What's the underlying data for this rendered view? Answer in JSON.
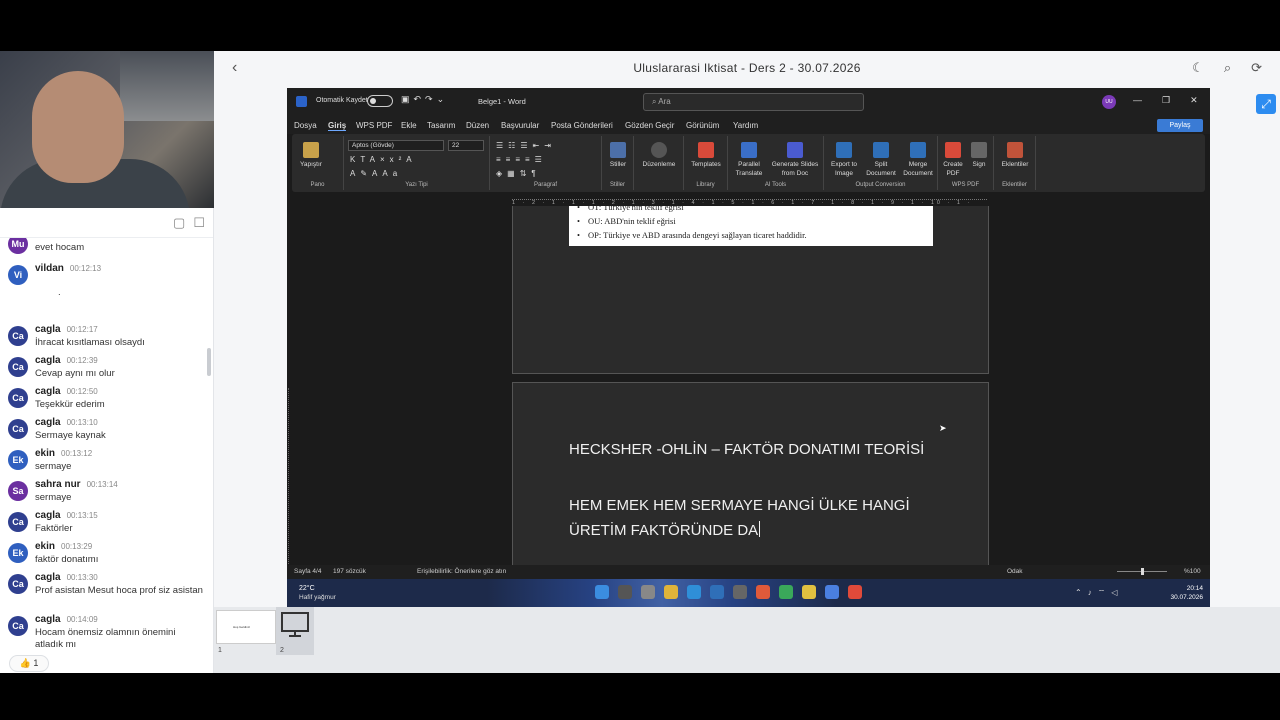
{
  "header": {
    "title": "Uluslararasi Iktisat - Ders 2 - 30.07.2026",
    "back_icon": "‹",
    "icons": [
      "moon-icon",
      "search-icon",
      "refresh-icon"
    ]
  },
  "chat": {
    "messages": [
      {
        "initials": "Mu",
        "name": "",
        "time": "",
        "text": "evet hocam"
      },
      {
        "initials": "Vi",
        "name": "vildan",
        "time": "00:12:13",
        "text": "."
      },
      {
        "initials": "Ca",
        "name": "cagla",
        "time": "00:12:17",
        "text": "İhracat kısıtlaması olsaydı"
      },
      {
        "initials": "Ca",
        "name": "cagla",
        "time": "00:12:39",
        "text": "Cevap aynı mı olur"
      },
      {
        "initials": "Ca",
        "name": "cagla",
        "time": "00:12:50",
        "text": "Teşekkür ederim"
      },
      {
        "initials": "Ca",
        "name": "cagla",
        "time": "00:13:10",
        "text": "Sermaye kaynak"
      },
      {
        "initials": "Ek",
        "name": "ekin",
        "time": "00:13:12",
        "text": "sermaye"
      },
      {
        "initials": "Sa",
        "name": "sahra nur",
        "time": "00:13:14",
        "text": "sermaye"
      },
      {
        "initials": "Ca",
        "name": "cagla",
        "time": "00:13:15",
        "text": "Faktörler"
      },
      {
        "initials": "Ek",
        "name": "ekin",
        "time": "00:13:29",
        "text": "faktör donatımı"
      },
      {
        "initials": "Ca",
        "name": "cagla",
        "time": "00:13:30",
        "text": "Prof asistan Mesut hoca prof siz asistan"
      },
      {
        "initials": "Ca",
        "name": "cagla",
        "time": "00:14:09",
        "text": "Hocam önemsiz olamnın önemini atladık mı"
      }
    ],
    "reaction": "👍 1"
  },
  "word": {
    "autosave": "Otomatik Kaydet",
    "doc_name": "Belge1 - Word",
    "search_placeholder": "Ara",
    "user_initials": "UU",
    "menu": [
      "Dosya",
      "Giriş",
      "WPS PDF",
      "Ekle",
      "Tasarım",
      "Düzen",
      "Başvurular",
      "Posta Gönderileri",
      "Gözden Geçir",
      "Görünüm",
      "Yardım"
    ],
    "share": "Paylaş",
    "font_name": "Aptos (Gövde)",
    "font_size": "22",
    "ribbon_groups": [
      "Pano",
      "Yazı Tipi",
      "Paragraf",
      "Stiller",
      "Library",
      "AI Tools",
      "Output Conversion",
      "WPS PDF",
      "Eklentiler"
    ],
    "ribbon_buttons": {
      "paste": "Yapıştır",
      "styles": "Stiller",
      "editing": "Düzenleme",
      "templates": "Templates",
      "parallel": "Parallel Translate",
      "generate": "Generate Slides from Doc",
      "export": "Export to Image",
      "split": "Split Document",
      "merge": "Merge Document",
      "create_pdf": "Create PDF",
      "sign": "Sign",
      "addins": "Eklentiler"
    },
    "ruler": "1 · 2 · 1 · 1 · 1 · 2 · 1 · 3 · 1 · 4 · 1 · 5 · 1 · 6 · 1 · 7 · 1 · 8 · 1 · 9 · 1 · 10 · 1 · 11 · 1 · 12 · 1 · 13 · 1 · 14 · 1 · 15",
    "bullets": [
      "OT: Türkiye'nin teklif eğrisi",
      "OU: ABD'nin teklif eğrisi",
      "OP: Türkiye ve ABD arasında dengeyi sağlayan ticaret haddidir."
    ],
    "page2_lines": [
      "HECKSHER -OHLİN – FAKTÖR DONATIMI TEORİSİ",
      "HEM EMEK HEM SERMAYE HANGİ ÜLKE HANGİ ÜRETİM FAKTÖRÜNDE DA"
    ],
    "status": {
      "page": "Sayfa 4/4",
      "words": "197 sözcük",
      "accessibility": "Erişilebilirlik: Önerilere göz atın",
      "focus": "Odak",
      "zoom": "%100"
    }
  },
  "taskbar": {
    "temp": "22°C",
    "weather": "Hafif yağmur",
    "time": "20:14",
    "date": "30.07.2026"
  },
  "thumbnails": {
    "labels": [
      "1",
      "2"
    ],
    "mini_text": "Hoş Geldiniz"
  },
  "colors": {
    "accent": "#2d8cf0",
    "word_blue": "#2b63c9",
    "avatar_default": "#2f3f8f"
  }
}
